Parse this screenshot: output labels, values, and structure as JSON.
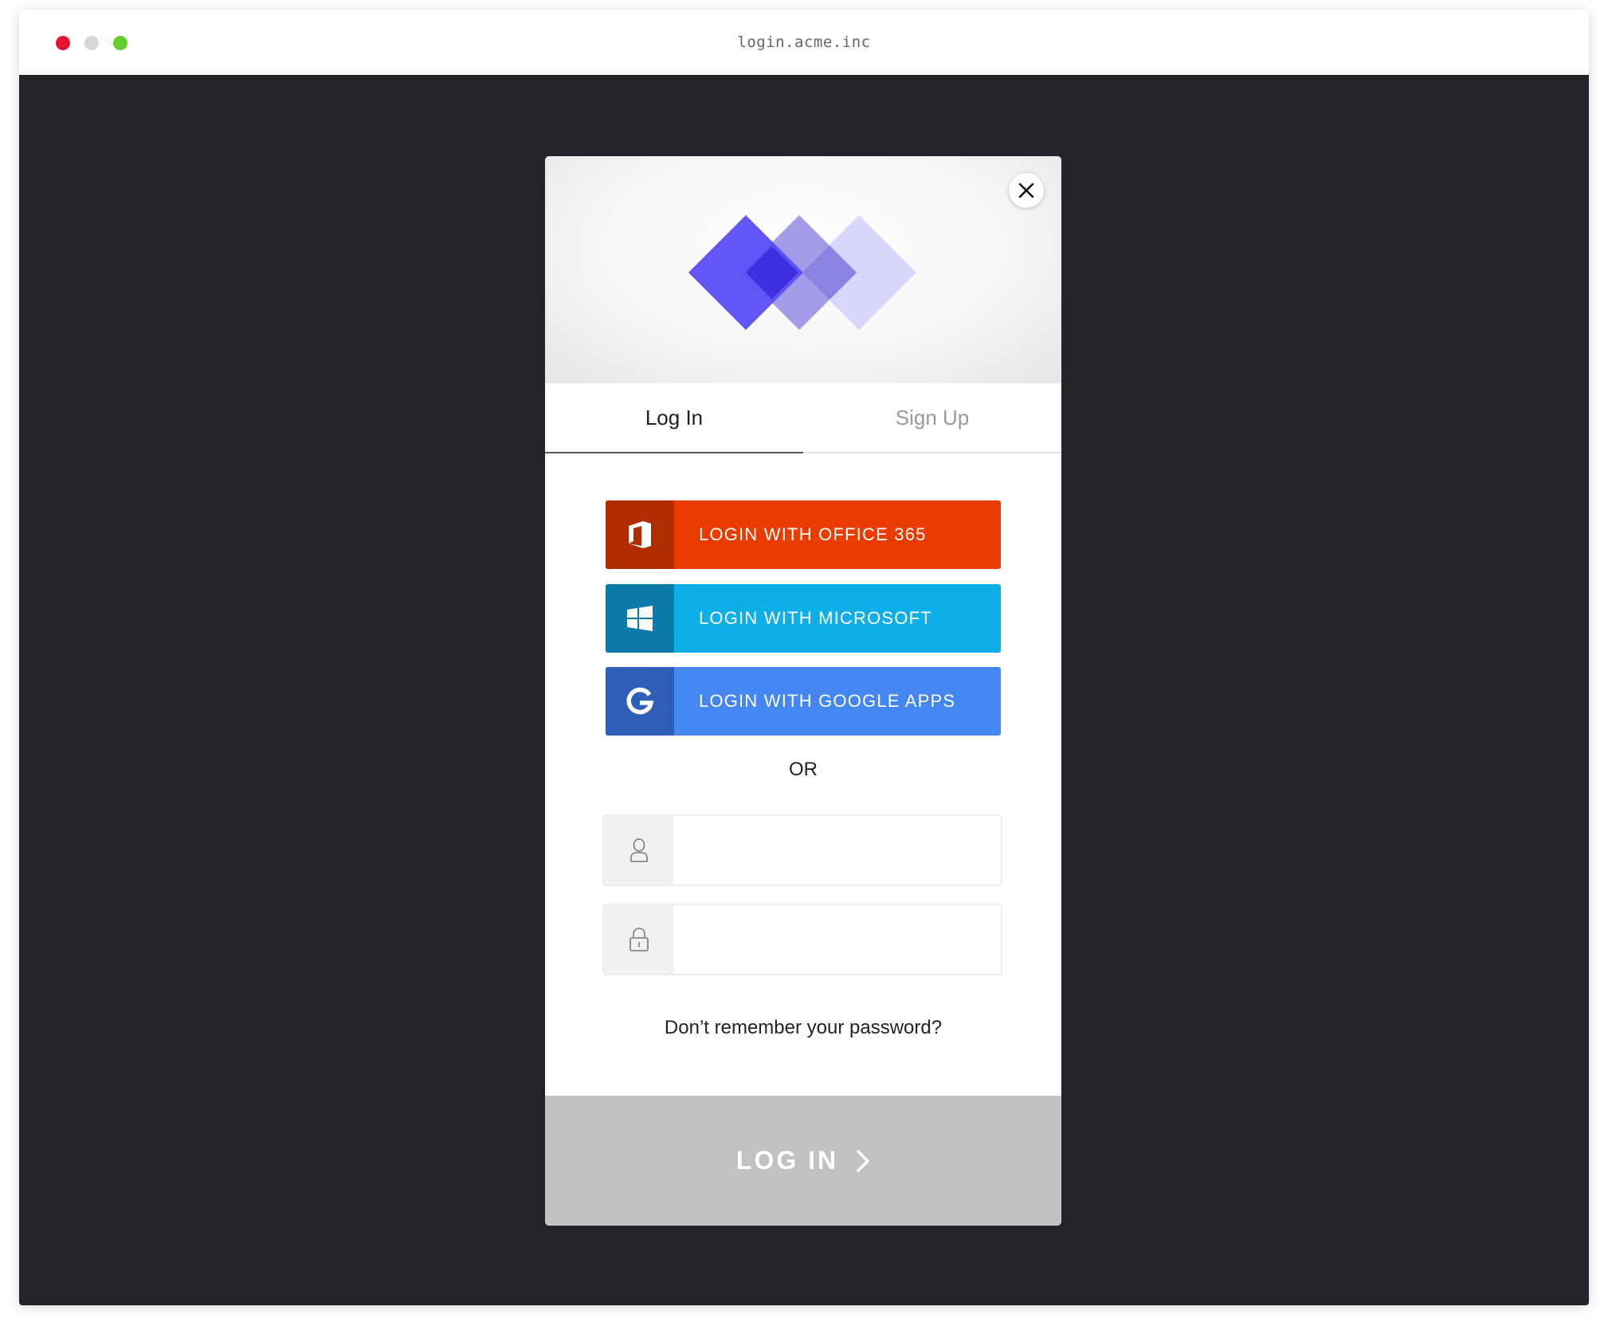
{
  "window": {
    "url": "login.acme.inc",
    "lights": {
      "close": "#e8132f",
      "minimize": "#d7d7d7",
      "zoom": "#62cd2b"
    }
  },
  "modal": {
    "close_icon": "close-icon",
    "tabs": [
      {
        "label": "Log In",
        "active": true
      },
      {
        "label": "Sign Up",
        "active": false
      }
    ],
    "social": [
      {
        "label": "LOGIN WITH OFFICE 365",
        "icon": "office-icon",
        "color": "#eb3c00",
        "icon_bg": "#b02d00"
      },
      {
        "label": "LOGIN WITH MICROSOFT",
        "icon": "windows-icon",
        "color": "#0eaee8",
        "icon_bg": "#0c7aa8"
      },
      {
        "label": "LOGIN WITH GOOGLE APPS",
        "icon": "google-icon",
        "color": "#4587f2",
        "icon_bg": "#2e5eb5"
      }
    ],
    "separator": "OR",
    "fields": {
      "username": {
        "value": "",
        "placeholder": "",
        "icon": "user-icon"
      },
      "password": {
        "value": "",
        "placeholder": "",
        "icon": "lock-icon"
      }
    },
    "forgot": "Don’t remember your password?",
    "submit": {
      "label": "LOG IN",
      "icon": "chevron-right-icon",
      "color": "#c2c2c2"
    }
  },
  "colors": {
    "background": "#232329",
    "logo_primary": "#5b4cf5",
    "logo_secondary": "#9d97e8",
    "logo_tertiary": "#d8d6fa"
  }
}
